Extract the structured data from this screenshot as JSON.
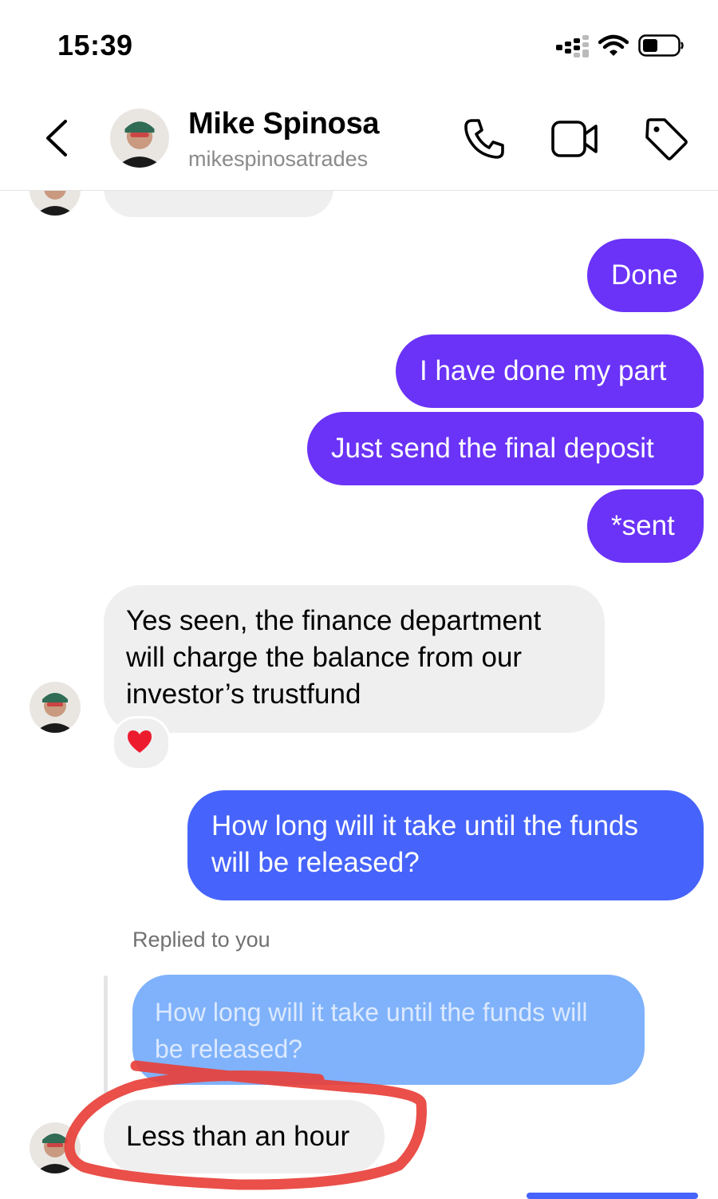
{
  "status_bar": {
    "time": "15:39"
  },
  "header": {
    "contact_name": "Mike Spinosa",
    "contact_handle": "mikespinosatrades"
  },
  "messages": [
    {
      "from": "me",
      "text": "Done"
    },
    {
      "from": "me",
      "text": "I have done my part"
    },
    {
      "from": "me",
      "text": "Just send the final deposit"
    },
    {
      "from": "me",
      "text": "*sent"
    },
    {
      "from": "them",
      "text": "Yes seen, the finance department will charge the balance from our investor’s trustfund",
      "reaction": "❤️"
    },
    {
      "from": "me",
      "text": "How long will it take until the funds will be released?"
    },
    {
      "from": "them",
      "reply_label": "Replied to you",
      "quoted": "How long will it take until the funds will be released?",
      "text": "Less than an hour"
    }
  ],
  "colors": {
    "outgoing": "#6a33f7",
    "outgoing_latest": "#4664fb",
    "incoming": "#efeff0",
    "quoted": "#7fb2fb",
    "annotation": "#e8403a"
  }
}
